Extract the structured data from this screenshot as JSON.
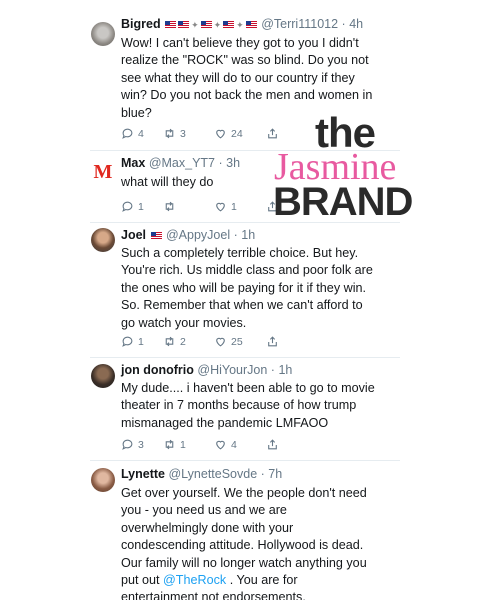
{
  "tweets": [
    {
      "name": "Bigred",
      "handle": "@Terri111012",
      "time": "4h",
      "lines": [
        "Wow! I can't believe they got to you I didn't",
        "realize the \"ROCK\" was so blind. Do you not",
        "see what they will do to our country if they",
        "win? Do you not back the men and women in",
        "blue?"
      ],
      "replies": "4",
      "retweets": "3",
      "likes": "24"
    },
    {
      "name": "Max",
      "handle": "@Max_YT7",
      "time": "3h",
      "lines": [
        "what will they do"
      ],
      "replies": "1",
      "retweets": "",
      "likes": "1"
    },
    {
      "name": "Joel",
      "handle": "@AppyJoel",
      "time": "1h",
      "lines": [
        "Such a completely terrible choice. But hey.",
        "You're rich. Us middle class and poor folk are",
        "the ones who will be paying for it if they win.",
        "So. Remember that when we can't afford to",
        "go watch your movies."
      ],
      "replies": "1",
      "retweets": "2",
      "likes": "25"
    },
    {
      "name": "jon donofrio",
      "handle": "@HiYourJon",
      "time": "1h",
      "lines": [
        "My dude.... i haven't been able to go to movie",
        "theater in 7 months because of how trump",
        "mismanaged the pandemic LMFAOO"
      ],
      "replies": "3",
      "retweets": "1",
      "likes": "4"
    },
    {
      "name": "Lynette",
      "handle": "@LynetteSovde",
      "time": "7h",
      "lines": [
        "Get over yourself. We the people don't need",
        "you - you need us and we are",
        "overwhelmingly done with your",
        "condescending attitude. Hollywood is dead.",
        "Our family will no longer watch anything you"
      ],
      "last_line_pre": "put out ",
      "last_line_mention": "@TheRock",
      "last_line_post": " . You are for",
      "final_line": "entertainment not endorsements."
    }
  ],
  "separator": "·",
  "watermark": {
    "line1": "the",
    "line2": "Jasmine",
    "line3": "BRAND"
  },
  "max_avatar_letter": "M",
  "colors": {
    "accent": "#1da1f2",
    "muted": "#657786",
    "brand_pink": "#e85aa0"
  }
}
